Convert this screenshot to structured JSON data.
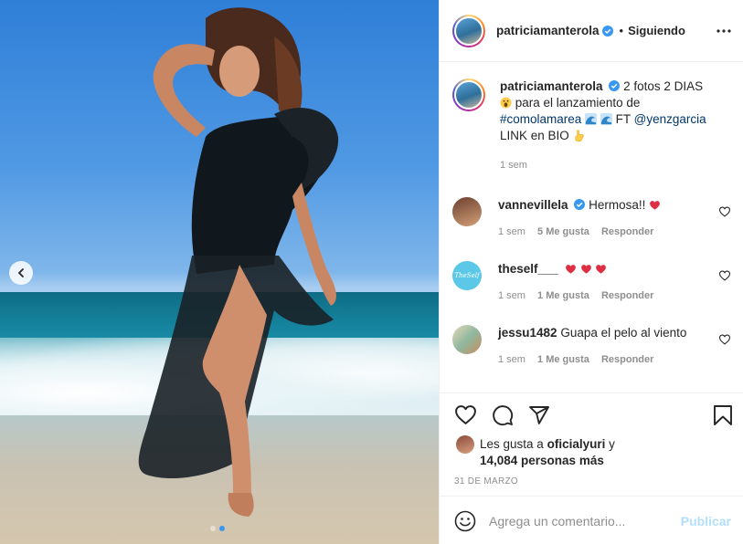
{
  "post": {
    "author": "patriciamanterola",
    "follow_separator": "•",
    "follow_label": "Siguiendo",
    "caption": {
      "username": "patriciamanterola",
      "part1": "2 fotos 2 DIAS",
      "part2": "para el lanzamiento de",
      "hashtag": "#comolamarea",
      "ft": "FT",
      "mention": "@yenzgarcia",
      "link_text": "LINK en BIO",
      "time": "1 sem"
    }
  },
  "comments": [
    {
      "username": "vannevillela",
      "text": "Hermosa!!",
      "time": "1 sem",
      "likes": "5 Me gusta",
      "reply": "Responder",
      "verified": true
    },
    {
      "username": "theself___",
      "text": "",
      "time": "1 sem",
      "likes": "1 Me gusta",
      "reply": "Responder",
      "verified": false,
      "avatar_text": "TheSelf"
    },
    {
      "username": "jessu1482",
      "text": "Guapa el pelo al viento",
      "time": "1 sem",
      "likes": "1 Me gusta",
      "reply": "Responder",
      "verified": false
    }
  ],
  "likes": {
    "prefix": "Les gusta a",
    "user": "oficialyuri",
    "conj": "y",
    "others": "14,084 personas más"
  },
  "date": "31 DE MARZO",
  "add_comment": {
    "placeholder": "Agrega un comentario...",
    "publish_label": "Publicar"
  },
  "carousel": {
    "slides": 2,
    "active": 2
  },
  "colors": {
    "verified": "#3897f0",
    "link": "#00376b",
    "heart": "#ed4956",
    "publish_disabled": "#b2dffc"
  },
  "icons": [
    "chevron-left-icon",
    "more-icon",
    "verified-icon",
    "heart-icon",
    "comment-icon",
    "share-icon",
    "bookmark-icon",
    "emoji-icon"
  ]
}
